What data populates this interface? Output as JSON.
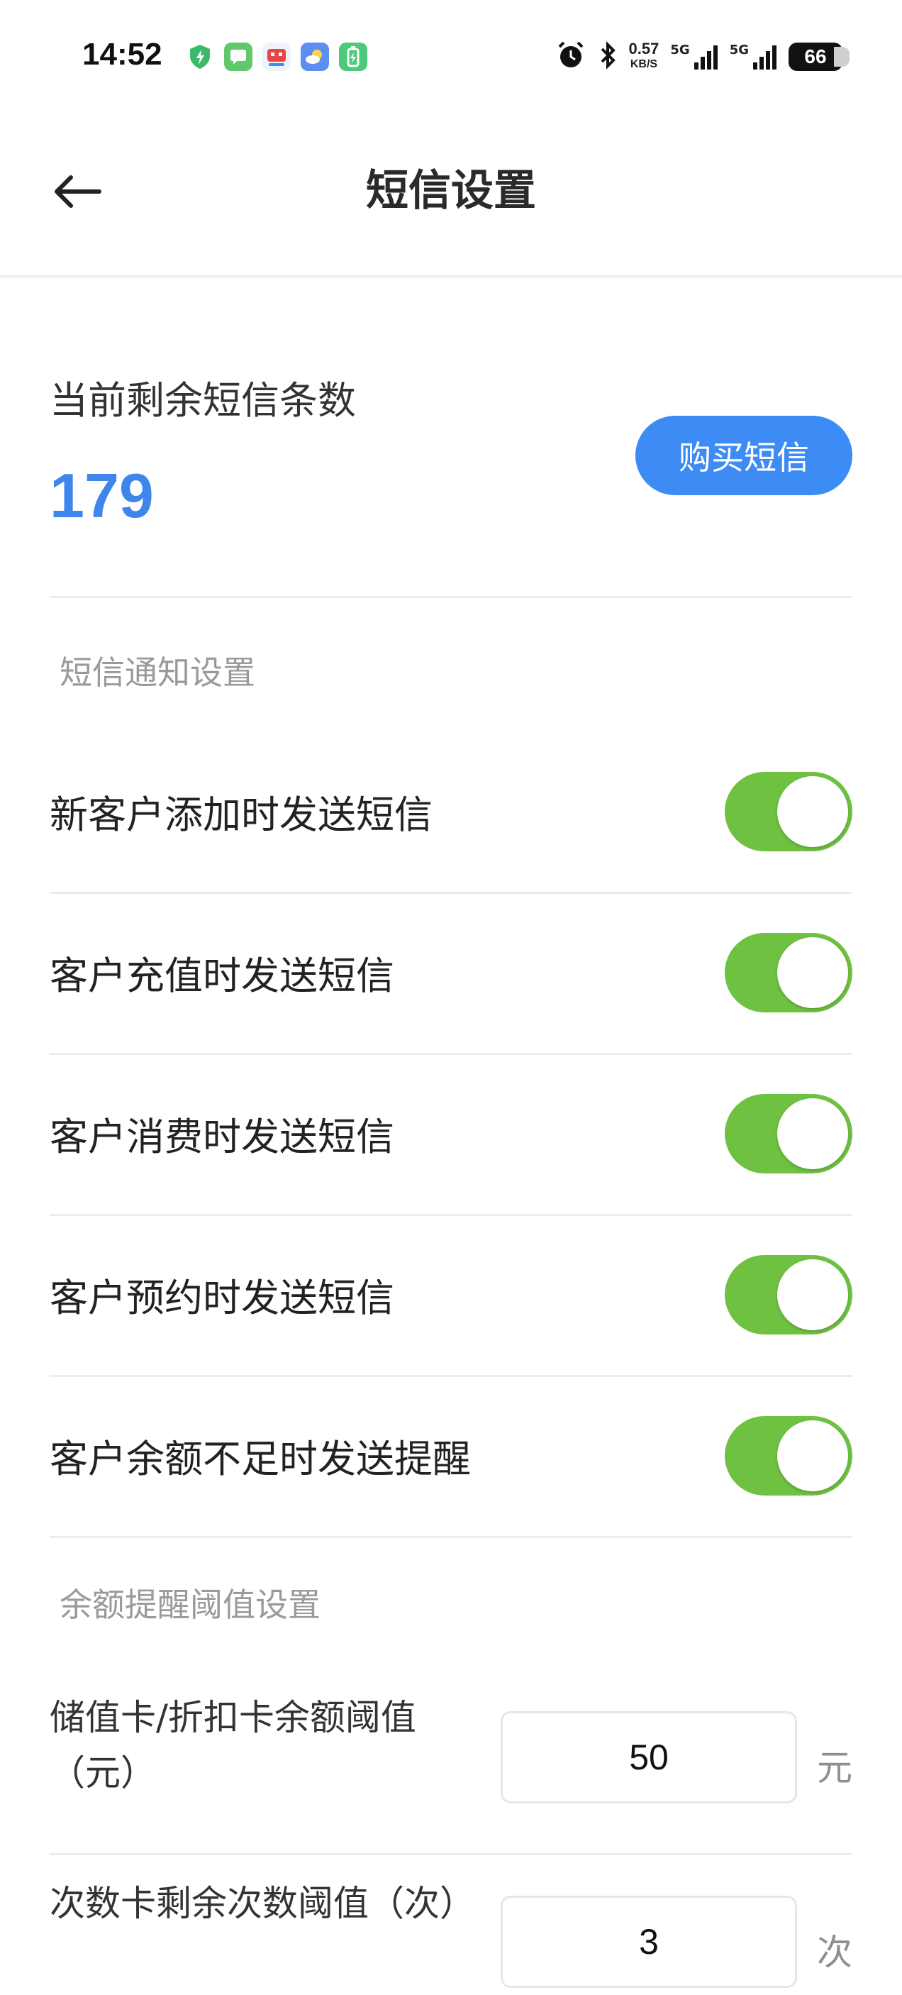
{
  "status_bar": {
    "time": "14:52",
    "net_speed_value": "0.57",
    "net_speed_unit": "KB/S",
    "signal1": "5G",
    "signal2": "5G",
    "battery": "66"
  },
  "header": {
    "title": "短信设置"
  },
  "balance": {
    "label": "当前剩余短信条数",
    "value": "179",
    "buy_button": "购买短信"
  },
  "notify_section": {
    "title": "短信通知设置",
    "items": [
      {
        "label": "新客户添加时发送短信",
        "on": true
      },
      {
        "label": "客户充值时发送短信",
        "on": true
      },
      {
        "label": "客户消费时发送短信",
        "on": true
      },
      {
        "label": "客户预约时发送短信",
        "on": true
      },
      {
        "label": "客户余额不足时发送提醒",
        "on": true
      }
    ]
  },
  "threshold_section": {
    "title": "余额提醒阈值设置",
    "items": [
      {
        "label_line1": "储值卡/折扣卡余额阈值",
        "label_line2": "（元）",
        "value": "50",
        "unit": "元"
      },
      {
        "label_line1": "次数卡剩余次数阈值（次）",
        "value": "3",
        "unit": "次"
      }
    ]
  },
  "colors": {
    "accent": "#3d8bf5",
    "toggle_on": "#6fc141",
    "value_blue": "#3e86ec"
  }
}
